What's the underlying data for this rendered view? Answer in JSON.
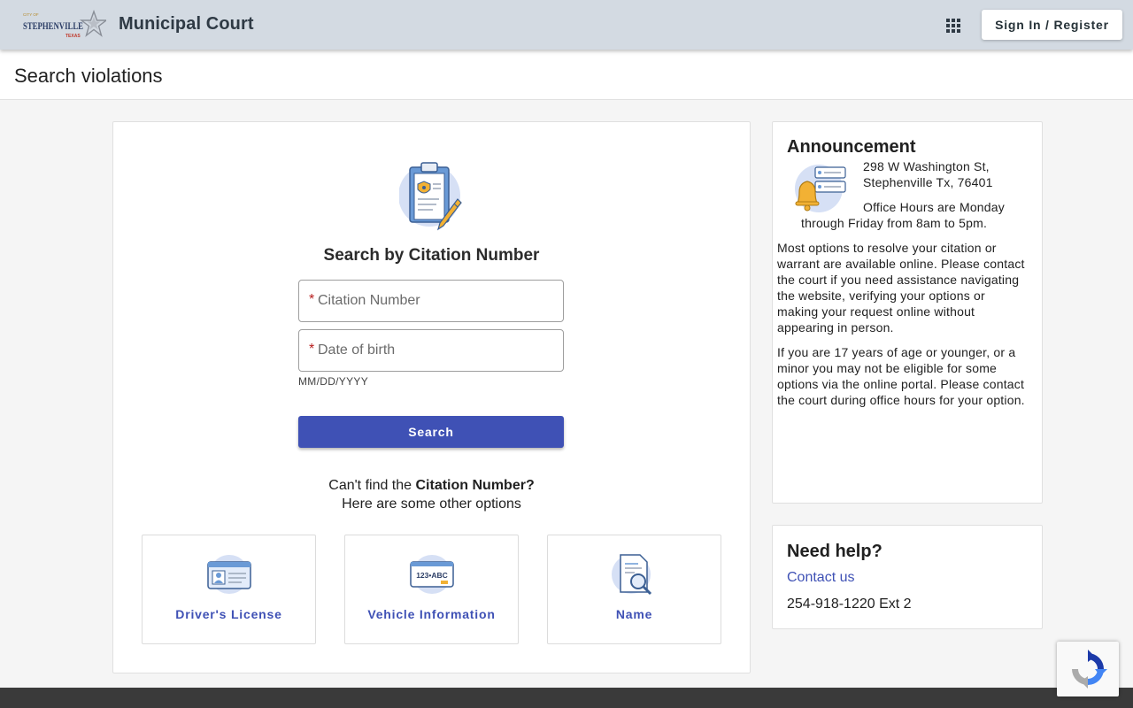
{
  "header": {
    "logo_text": "STEPHENVILLE",
    "logo_subtext": "TEXAS",
    "logo_top_text": "CITY OF",
    "title": "Municipal Court",
    "apps_icon": "apps-grid-icon",
    "signin_label": "Sign In / Register"
  },
  "page": {
    "title": "Search violations"
  },
  "search": {
    "icon": "clipboard-badge-icon",
    "title": "Search by Citation Number",
    "required_mark": "*",
    "citation_placeholder": "Citation Number",
    "dob_placeholder": "Date of birth",
    "dob_hint": "MM/DD/YYYY",
    "button_label": "Search",
    "cant_find_prefix": "Can't find the ",
    "cant_find_bold": "Citation Number?",
    "cant_find_line2": "Here are some other options",
    "options": [
      {
        "label": "Driver's License",
        "icon": "id-card-icon"
      },
      {
        "label": "Vehicle Information",
        "icon": "license-plate-icon",
        "plate_text": "123•ABC"
      },
      {
        "label": "Name",
        "icon": "document-search-icon"
      }
    ]
  },
  "announcement": {
    "title": "Announcement",
    "icon": "bell-notification-icon",
    "address_line1": "298 W Washington St,",
    "address_line2": "Stephenville Tx, 76401",
    "hours": "Office Hours are Monday through Friday from 8am to 5pm.",
    "paragraph1": "Most options to resolve your citation or warrant are available online. Please contact the court if you need assistance navigating the website, verifying your options or making your request online without appearing in person.",
    "paragraph2": "If you are 17 years of age or younger, or a minor you may not be eligible for some options via the online portal. Please contact the court during office hours for your option."
  },
  "help": {
    "title": "Need help?",
    "contact_label": "Contact us",
    "phone": "254-918-1220 Ext 2"
  },
  "colors": {
    "header_bg": "#d3dae2",
    "primary": "#3f51b5",
    "required": "#b71c1c",
    "footer": "#3a3a3a"
  }
}
